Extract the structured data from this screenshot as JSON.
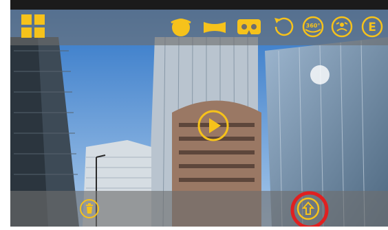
{
  "colors": {
    "accent": "#f6c21b",
    "toolbar": "#6e6e6e",
    "highlight": "#e02020",
    "sky": "#4f8fd0"
  },
  "toolbar": {
    "items": [
      {
        "name": "grid-view-icon",
        "label": ""
      },
      {
        "name": "little-planet-icon",
        "label": ""
      },
      {
        "name": "crystal-ball-icon",
        "label": ""
      },
      {
        "name": "vr-glasses-icon",
        "label": ""
      },
      {
        "name": "rotate-icon",
        "label": ""
      },
      {
        "name": "view-360-icon",
        "label": "360°"
      },
      {
        "name": "gyro-icon",
        "label": ""
      },
      {
        "name": "e-mode-icon",
        "label": "E"
      }
    ]
  },
  "bottom_bar": {
    "items": [
      {
        "name": "delete-icon"
      },
      {
        "name": "upload-icon"
      }
    ]
  },
  "center": {
    "name": "play-icon"
  }
}
